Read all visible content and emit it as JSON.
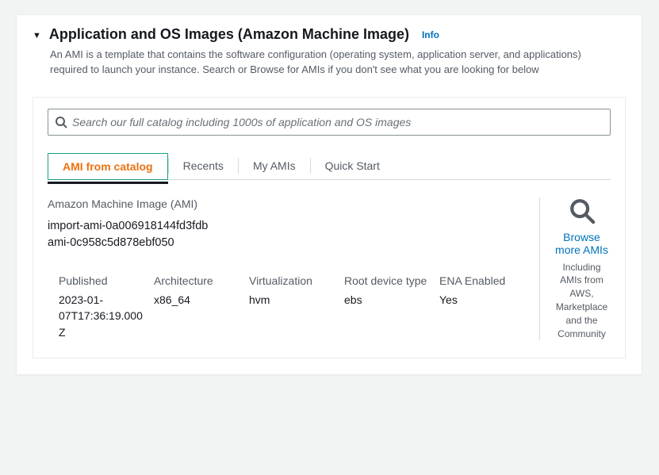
{
  "header": {
    "title": "Application and OS Images (Amazon Machine Image)",
    "info": "Info",
    "description": "An AMI is a template that contains the software configuration (operating system, application server, and applications) required to launch your instance. Search or Browse for AMIs if you don't see what you are looking for below"
  },
  "search": {
    "placeholder": "Search our full catalog including 1000s of application and OS images"
  },
  "tabs": {
    "items": [
      {
        "label": "AMI from catalog",
        "active": true
      },
      {
        "label": "Recents",
        "active": false
      },
      {
        "label": "My AMIs",
        "active": false
      },
      {
        "label": "Quick Start",
        "active": false
      }
    ]
  },
  "ami": {
    "heading": "Amazon Machine Image (AMI)",
    "name": "import-ami-0a006918144fd3fdb",
    "id": "ami-0c958c5d878ebf050",
    "browse_label": "Browse more AMIs",
    "browse_sub": "Including AMIs from AWS, Marketplace and the Community",
    "props": {
      "published": {
        "label": "Published",
        "value": "2023-01-07T17:36:19.000Z"
      },
      "architecture": {
        "label": "Architecture",
        "value": "x86_64"
      },
      "virtualization": {
        "label": "Virtualization",
        "value": "hvm"
      },
      "root_device": {
        "label": "Root device type",
        "value": "ebs"
      },
      "ena": {
        "label": "ENA Enabled",
        "value": "Yes"
      }
    }
  }
}
